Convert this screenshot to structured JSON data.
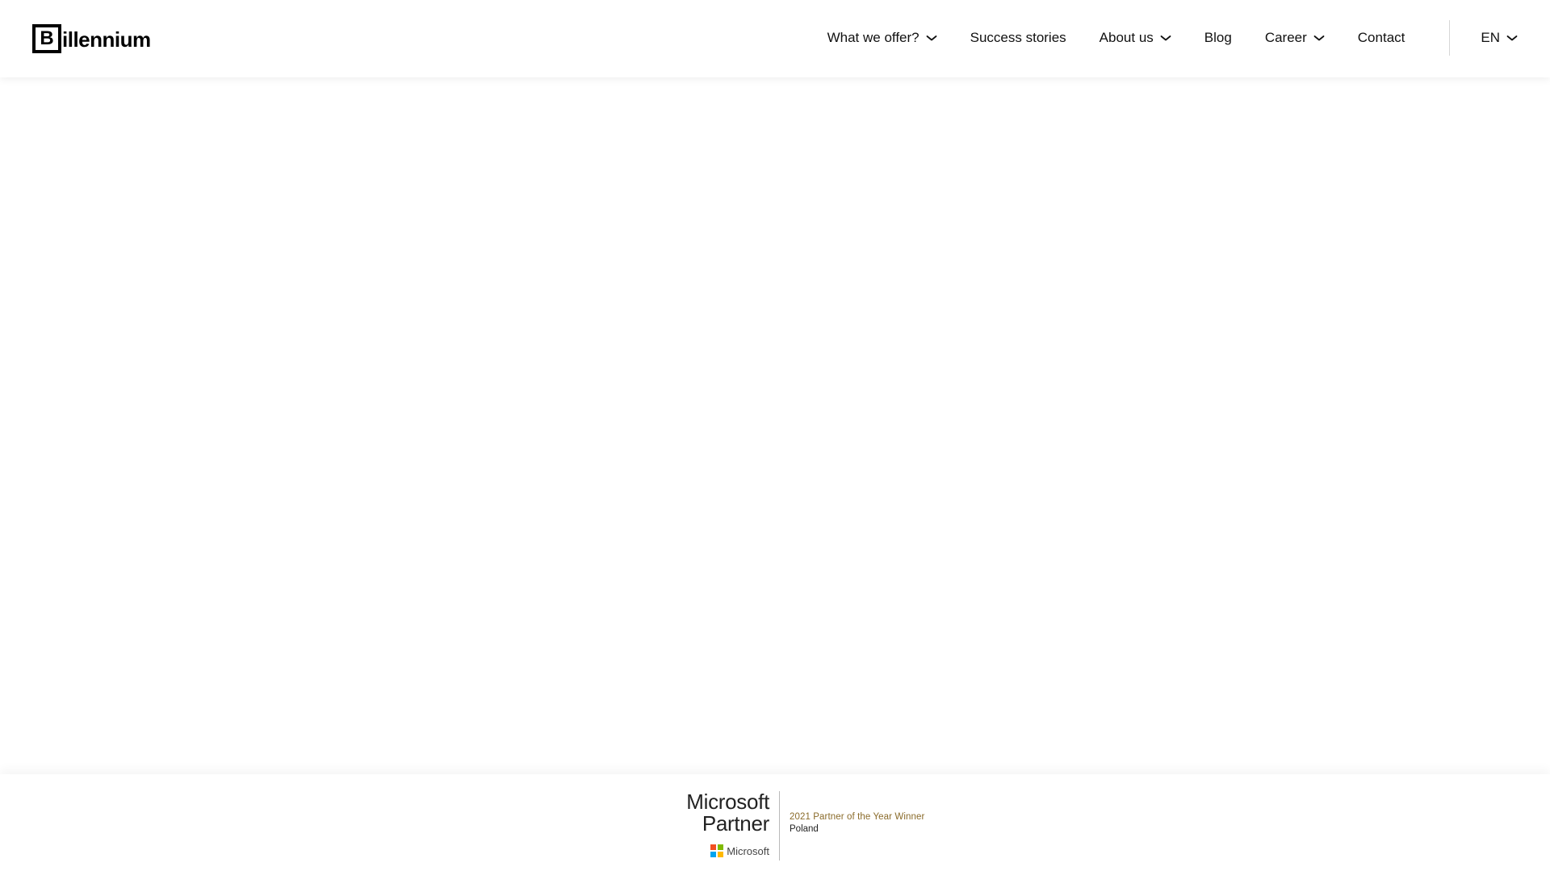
{
  "brand": {
    "logo_letter": "B",
    "logo_text": "illennium"
  },
  "nav": {
    "items": [
      {
        "label": "What we offer?",
        "has_dropdown": true
      },
      {
        "label": "Success stories",
        "has_dropdown": false
      },
      {
        "label": "About us",
        "has_dropdown": true
      },
      {
        "label": "Blog",
        "has_dropdown": false
      },
      {
        "label": "Career",
        "has_dropdown": true
      },
      {
        "label": "Contact",
        "has_dropdown": false
      }
    ],
    "language": {
      "label": "EN",
      "has_dropdown": true
    }
  },
  "footer": {
    "badge": {
      "title_line1": "Microsoft",
      "title_line2": "Partner",
      "brand_label": "Microsoft",
      "award": "2021 Partner of the Year Winner",
      "country": "Poland",
      "colors": {
        "red": "#f25022",
        "green": "#7fba00",
        "blue": "#00a4ef",
        "yellow": "#ffb900",
        "award_text": "#8a6b2a"
      }
    }
  },
  "icons": {
    "dropdown": "chevron-down-icon",
    "ms_logo": "microsoft-logo-icon"
  }
}
